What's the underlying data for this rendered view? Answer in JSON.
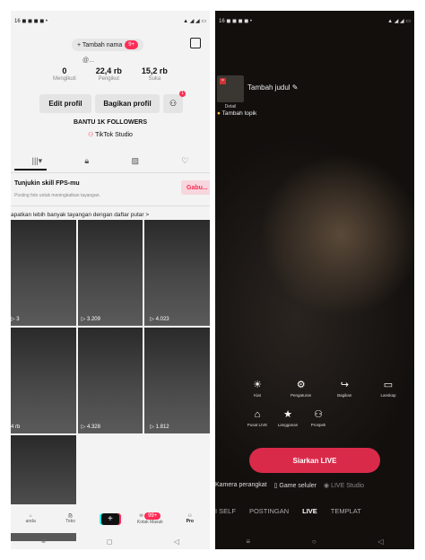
{
  "left": {
    "status": {
      "left": "16 ◼ ◼ ◼ ◼ •",
      "right": "▲ ◢ ◢ ▭"
    },
    "name_pill": {
      "label": "+ Tambah nama",
      "badge": "9+"
    },
    "handle": "@...",
    "stats": [
      {
        "value": "0",
        "label": "Mengikuti"
      },
      {
        "value": "22,4 rb",
        "label": "Pengikut"
      },
      {
        "value": "15,2 rb",
        "label": "Suka"
      }
    ],
    "edit_profile": "Edit profil",
    "share_profile": "Bagikan profil",
    "add_friend_badge": "1",
    "bio": "BANTU 1K FOLLOWERS",
    "studio": "TikTok Studio",
    "skill": {
      "title": "Tunjukin skill FPS-mu",
      "subtitle": "Posting foto untuk meningkatkan tayangan.",
      "join": "Gabu..."
    },
    "promo": "apatkan lebih banyak tayangan dengan daftar putar >",
    "videos": [
      "▷ 3",
      "▷ 3.209",
      "▷ 4.023",
      "4 rb",
      "▷ 4.328",
      "▷ 1.812",
      ""
    ],
    "nav": [
      {
        "label": "anda"
      },
      {
        "label": "Toko"
      },
      {
        "label": ""
      },
      {
        "label": "Kotak Masuk",
        "badge": "99+"
      },
      {
        "label": "Pro"
      }
    ],
    "sys": [
      "≡",
      "◻",
      "◁"
    ]
  },
  "right": {
    "status": {
      "left": "16 ◼ ◼ ◼ ◼ •",
      "right": "▲ ◢ ◢ ▭"
    },
    "thumb_label": "Detail",
    "title": "Tambah judul ✎",
    "topic": "Tambah topik",
    "tools_row1": [
      {
        "icon": "bulb-icon",
        "glyph": "☀",
        "label": "Kiat"
      },
      {
        "icon": "gear-icon",
        "glyph": "⚙",
        "label": "Pengaturan"
      },
      {
        "icon": "share-icon",
        "glyph": "↪",
        "label": "Bagikan"
      },
      {
        "icon": "landscape-icon",
        "glyph": "▭",
        "label": "Lanskap"
      }
    ],
    "tools_row2": [
      {
        "icon": "home-icon",
        "glyph": "⌂",
        "label": "Pusat LIVE"
      },
      {
        "icon": "star-icon",
        "glyph": "★",
        "label": "Langganan"
      },
      {
        "icon": "person-icon",
        "glyph": "⚇",
        "label": "Prospek"
      }
    ],
    "go_live": "Siarkan LIVE",
    "options": [
      "Kamera perangkat",
      "▯ Game seluler",
      "◉ LIVE Studio"
    ],
    "modes": [
      "I SELF",
      "POSTINGAN",
      "LIVE",
      "TEMPLAT"
    ],
    "active_mode": "LIVE",
    "sys": [
      "≡",
      "○",
      "◁"
    ]
  }
}
